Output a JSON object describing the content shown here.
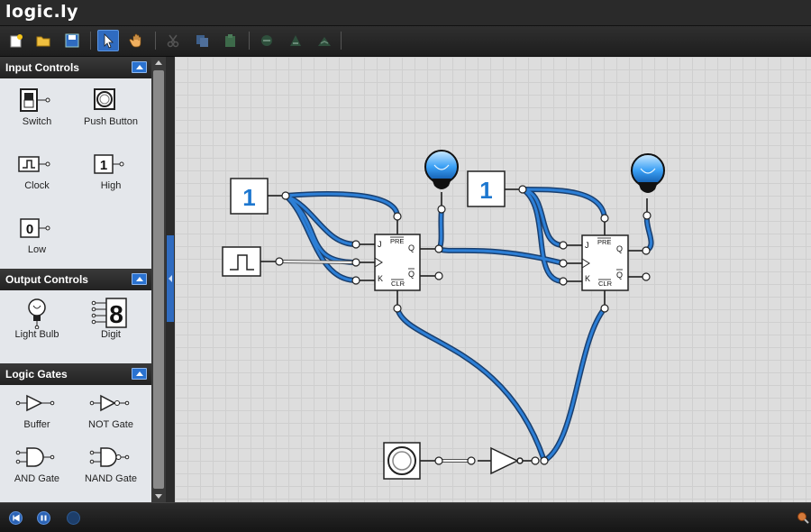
{
  "app": {
    "title": "logic.ly"
  },
  "toolbar": {
    "buttons": [
      {
        "name": "new-icon"
      },
      {
        "name": "open-icon"
      },
      {
        "name": "save-icon"
      },
      {
        "name": "select-pointer-icon"
      },
      {
        "name": "pan-hand-icon"
      },
      {
        "name": "cut-icon"
      },
      {
        "name": "copy-icon"
      },
      {
        "name": "paste-icon"
      },
      {
        "name": "zoom-out-icon"
      },
      {
        "name": "zoom-in-icon"
      },
      {
        "name": "zoom-fit-icon"
      }
    ]
  },
  "sidebar": {
    "sections": [
      {
        "title": "Input Controls",
        "items": [
          {
            "label": "Switch",
            "icon": "switch-icon"
          },
          {
            "label": "Push Button",
            "icon": "push-button-icon"
          },
          {
            "label": "Clock",
            "icon": "clock-icon"
          },
          {
            "label": "High",
            "icon": "high-constant-icon",
            "glyph": "1"
          },
          {
            "label": "Low",
            "icon": "low-constant-icon",
            "glyph": "0"
          }
        ]
      },
      {
        "title": "Output Controls",
        "items": [
          {
            "label": "Light Bulb",
            "icon": "light-bulb-icon"
          },
          {
            "label": "Digit",
            "icon": "digit-display-icon",
            "glyph": "8"
          }
        ]
      },
      {
        "title": "Logic Gates",
        "items": [
          {
            "label": "Buffer",
            "icon": "buffer-gate-icon"
          },
          {
            "label": "NOT Gate",
            "icon": "not-gate-icon"
          },
          {
            "label": "AND Gate",
            "icon": "and-gate-icon"
          },
          {
            "label": "NAND Gate",
            "icon": "nand-gate-icon"
          }
        ]
      }
    ]
  },
  "canvas": {
    "high_value_1": "1",
    "high_value_2": "1",
    "flipflop": {
      "j": "J",
      "k": "K",
      "q": "Q",
      "qbar": "Q",
      "pre": "PRE",
      "clr": "CLR"
    }
  },
  "colors": {
    "wire_active": "#1e6fc9",
    "accent": "#2f6bc0",
    "bulb_on": "#3aa0f5"
  },
  "statusbar": {
    "buttons": [
      {
        "name": "rewind-icon"
      },
      {
        "name": "pause-icon"
      },
      {
        "name": "step-icon"
      },
      {
        "name": "zoom-indicator-icon"
      }
    ]
  }
}
